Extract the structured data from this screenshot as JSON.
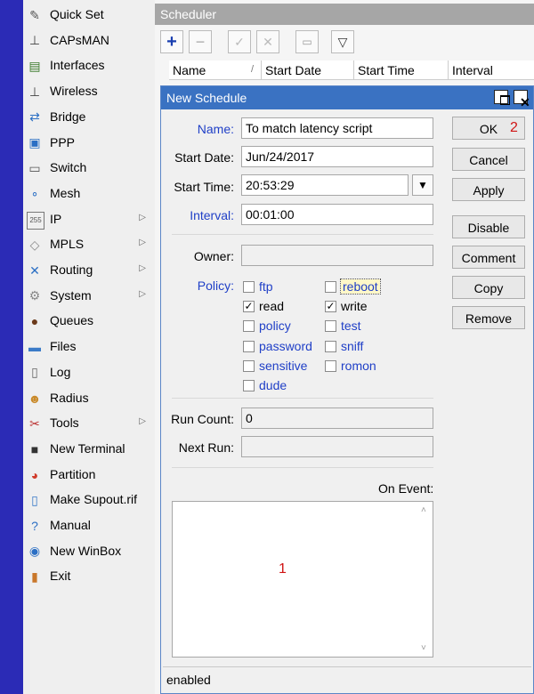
{
  "menu": [
    {
      "label": "Quick Set",
      "icon": "wrench-icon",
      "glyph": "✎",
      "color": "#555",
      "arrow": false
    },
    {
      "label": "CAPsMAN",
      "icon": "antenna-icon",
      "glyph": "⊥",
      "color": "#444",
      "arrow": false
    },
    {
      "label": "Interfaces",
      "icon": "interfaces-icon",
      "glyph": "▤",
      "color": "#3a7a2a",
      "arrow": false
    },
    {
      "label": "Wireless",
      "icon": "wireless-icon",
      "glyph": "⊥",
      "color": "#444",
      "arrow": false
    },
    {
      "label": "Bridge",
      "icon": "bridge-icon",
      "glyph": "⇄",
      "color": "#2b6fc4",
      "arrow": false
    },
    {
      "label": "PPP",
      "icon": "ppp-icon",
      "glyph": "▣",
      "color": "#2b6fc4",
      "arrow": false
    },
    {
      "label": "Switch",
      "icon": "switch-icon",
      "glyph": "▭",
      "color": "#555",
      "arrow": false
    },
    {
      "label": "Mesh",
      "icon": "mesh-icon",
      "glyph": "∘",
      "color": "#2b6fc4",
      "arrow": false
    },
    {
      "label": "IP",
      "icon": "ip-icon",
      "glyph": "255",
      "color": "#555",
      "arrow": true
    },
    {
      "label": "MPLS",
      "icon": "mpls-icon",
      "glyph": "◇",
      "color": "#888",
      "arrow": true
    },
    {
      "label": "Routing",
      "icon": "routing-icon",
      "glyph": "✕",
      "color": "#2b6fc4",
      "arrow": true
    },
    {
      "label": "System",
      "icon": "gear-icon",
      "glyph": "⚙",
      "color": "#888",
      "arrow": true
    },
    {
      "label": "Queues",
      "icon": "queues-icon",
      "glyph": "●",
      "color": "#6b3a1a",
      "arrow": false
    },
    {
      "label": "Files",
      "icon": "folder-icon",
      "glyph": "▬",
      "color": "#3b7bc8",
      "arrow": false
    },
    {
      "label": "Log",
      "icon": "log-icon",
      "glyph": "▯",
      "color": "#666",
      "arrow": false
    },
    {
      "label": "Radius",
      "icon": "radius-icon",
      "glyph": "☻",
      "color": "#c98a2a",
      "arrow": false
    },
    {
      "label": "Tools",
      "icon": "tools-icon",
      "glyph": "✂",
      "color": "#b33",
      "arrow": true
    },
    {
      "label": "New Terminal",
      "icon": "terminal-icon",
      "glyph": "■",
      "color": "#333",
      "arrow": false
    },
    {
      "label": "Partition",
      "icon": "partition-icon",
      "glyph": "◕",
      "color": "#d03a2a",
      "arrow": false
    },
    {
      "label": "Make Supout.rif",
      "icon": "supout-icon",
      "glyph": "▯",
      "color": "#3b7bc8",
      "arrow": false
    },
    {
      "label": "Manual",
      "icon": "help-icon",
      "glyph": "?",
      "color": "#2b6fc4",
      "arrow": false
    },
    {
      "label": "New WinBox",
      "icon": "winbox-icon",
      "glyph": "◉",
      "color": "#2b6fc4",
      "arrow": false
    },
    {
      "label": "Exit",
      "icon": "exit-icon",
      "glyph": "▮",
      "color": "#c9772a",
      "arrow": false
    }
  ],
  "scheduler": {
    "title": "Scheduler",
    "columns": [
      "Name",
      "Start Date",
      "Start Time",
      "Interval"
    ],
    "sort_marker": "/"
  },
  "dialog": {
    "title": "New Schedule",
    "labels": {
      "name": "Name:",
      "start_date": "Start Date:",
      "start_time": "Start Time:",
      "interval": "Interval:",
      "owner": "Owner:",
      "policy": "Policy:",
      "run_count": "Run Count:",
      "next_run": "Next Run:",
      "on_event": "On Event:"
    },
    "fields": {
      "name": "To match latency script",
      "start_date": "Jun/24/2017",
      "start_time": "20:53:29",
      "interval": "00:01:00",
      "owner": "",
      "run_count": "0",
      "next_run": ""
    },
    "policies": [
      {
        "label": "ftp",
        "checked": false
      },
      {
        "label": "reboot",
        "checked": false
      },
      {
        "label": "read",
        "checked": true
      },
      {
        "label": "write",
        "checked": true
      },
      {
        "label": "policy",
        "checked": false
      },
      {
        "label": "test",
        "checked": false
      },
      {
        "label": "password",
        "checked": false
      },
      {
        "label": "sniff",
        "checked": false
      },
      {
        "label": "sensitive",
        "checked": false
      },
      {
        "label": "romon",
        "checked": false
      },
      {
        "label": "dude",
        "checked": false
      }
    ],
    "buttons": [
      "OK",
      "Cancel",
      "Apply",
      "Disable",
      "Comment",
      "Copy",
      "Remove"
    ],
    "status": "enabled",
    "annotations": {
      "ok_marker": "2",
      "editor_marker": "1"
    }
  }
}
